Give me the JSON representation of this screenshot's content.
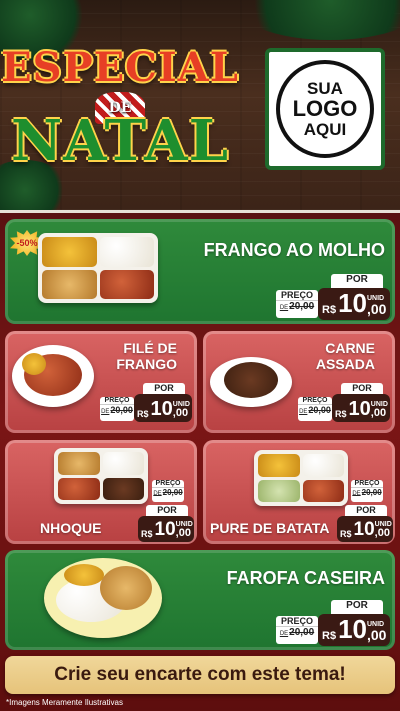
{
  "header": {
    "title_line1": "ESPECIAL",
    "title_de": "DE",
    "title_line2": "NATAL",
    "logo": {
      "line1": "SUA",
      "line2": "LOGO",
      "line3": "AQUI"
    }
  },
  "badge": "-50%",
  "products": [
    {
      "name": "FRANGO AO MOLHO",
      "old_label": "PREÇO",
      "old_prefix": "DE",
      "old_price": "20,00",
      "por": "POR",
      "currency": "R$",
      "price_int": "10",
      "price_cents": ",00",
      "unit": "UNID"
    },
    {
      "name_l1": "FILÉ DE",
      "name_l2": "FRANGO",
      "old_label": "PREÇO",
      "old_prefix": "DE",
      "old_price": "20,00",
      "por": "POR",
      "currency": "R$",
      "price_int": "10",
      "price_cents": ",00",
      "unit": "UNID"
    },
    {
      "name_l1": "CARNE",
      "name_l2": "ASSADA",
      "old_label": "PREÇO",
      "old_prefix": "DE",
      "old_price": "20,00",
      "por": "POR",
      "currency": "R$",
      "price_int": "10",
      "price_cents": ",00",
      "unit": "UNID"
    },
    {
      "name": "NHOQUE",
      "old_label": "PREÇO",
      "old_prefix": "DE",
      "old_price": "20,00",
      "por": "POR",
      "currency": "R$",
      "price_int": "10",
      "price_cents": ",00",
      "unit": "UNID"
    },
    {
      "name": "PURE DE BATATA",
      "old_label": "PREÇO",
      "old_prefix": "DE",
      "old_price": "20,00",
      "por": "POR",
      "currency": "R$",
      "price_int": "10",
      "price_cents": ",00",
      "unit": "UNID"
    },
    {
      "name": "FAROFA CASEIRA",
      "old_label": "PREÇO",
      "old_prefix": "DE",
      "old_price": "20,00",
      "por": "POR",
      "currency": "R$",
      "price_int": "10",
      "price_cents": ",00",
      "unit": "UNID"
    }
  ],
  "cta": "Crie seu encarte com este tema!",
  "footnote": "*Imagens Meramente Ilustrativas",
  "colors": {
    "green_panel": "#2f8a3b",
    "red_panel": "#c85253",
    "price_box": "#3a1a14",
    "cta_bg": "#ecd08d"
  }
}
